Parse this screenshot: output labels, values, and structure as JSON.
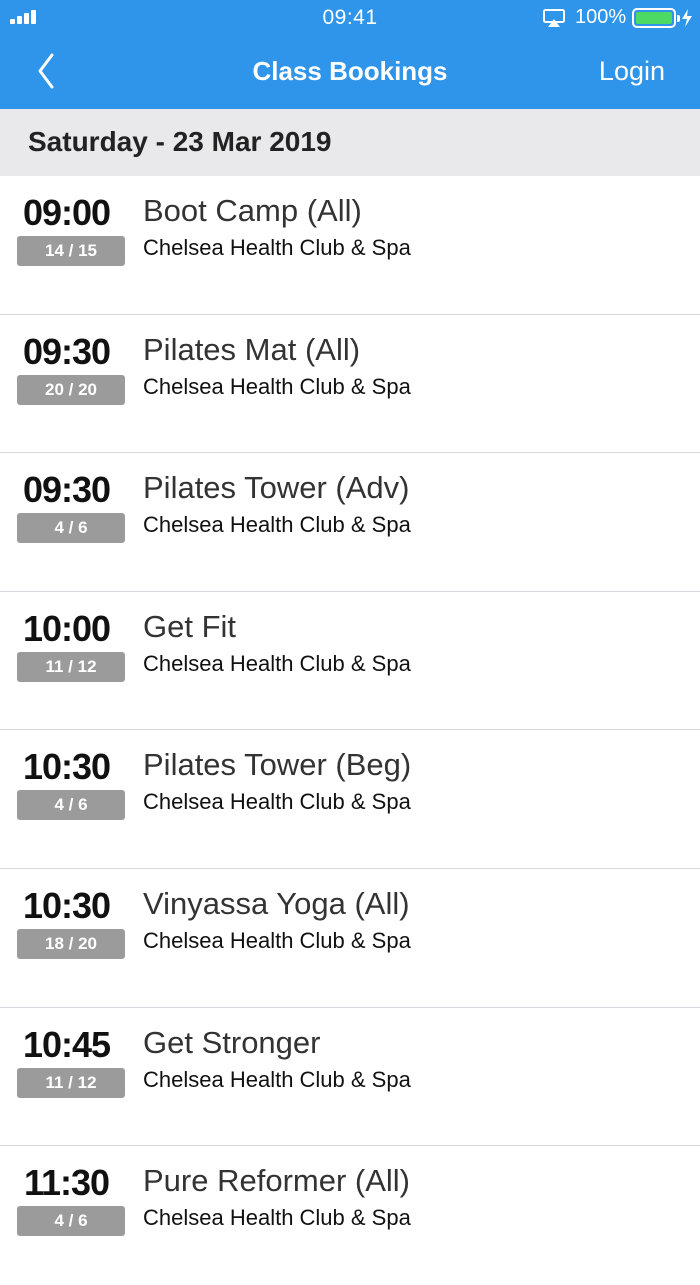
{
  "status_bar": {
    "time": "09:41",
    "battery": "100%",
    "battery_level": 1.0
  },
  "nav": {
    "title": "Class Bookings",
    "login_label": "Login",
    "back_icon": "chevron-left-icon"
  },
  "schedule": {
    "date_label": "Saturday - 23 Mar 2019",
    "classes": [
      {
        "time": "09:00",
        "capacity": "14 / 15",
        "name": "Boot Camp (All)",
        "venue": "Chelsea Health Club & Spa"
      },
      {
        "time": "09:30",
        "capacity": "20 / 20",
        "name": "Pilates Mat (All)",
        "venue": "Chelsea Health Club & Spa"
      },
      {
        "time": "09:30",
        "capacity": "4 / 6",
        "name": "Pilates Tower (Adv)",
        "venue": "Chelsea Health Club & Spa"
      },
      {
        "time": "10:00",
        "capacity": "11 / 12",
        "name": "Get Fit",
        "venue": "Chelsea Health Club & Spa"
      },
      {
        "time": "10:30",
        "capacity": "4 / 6",
        "name": "Pilates Tower (Beg)",
        "venue": "Chelsea Health Club & Spa"
      },
      {
        "time": "10:30",
        "capacity": "18 / 20",
        "name": "Vinyassa Yoga (All)",
        "venue": "Chelsea Health Club & Spa"
      },
      {
        "time": "10:45",
        "capacity": "11 / 12",
        "name": "Get Stronger",
        "venue": "Chelsea Health Club & Spa"
      },
      {
        "time": "11:30",
        "capacity": "4 / 6",
        "name": "Pure Reformer (All)",
        "venue": "Chelsea Health Club & Spa"
      }
    ]
  },
  "colors": {
    "header_blue": "#2f95ea",
    "date_bar": "#e9e9ec",
    "badge_gray": "#9b9b9b",
    "battery_green": "#4cd964"
  }
}
